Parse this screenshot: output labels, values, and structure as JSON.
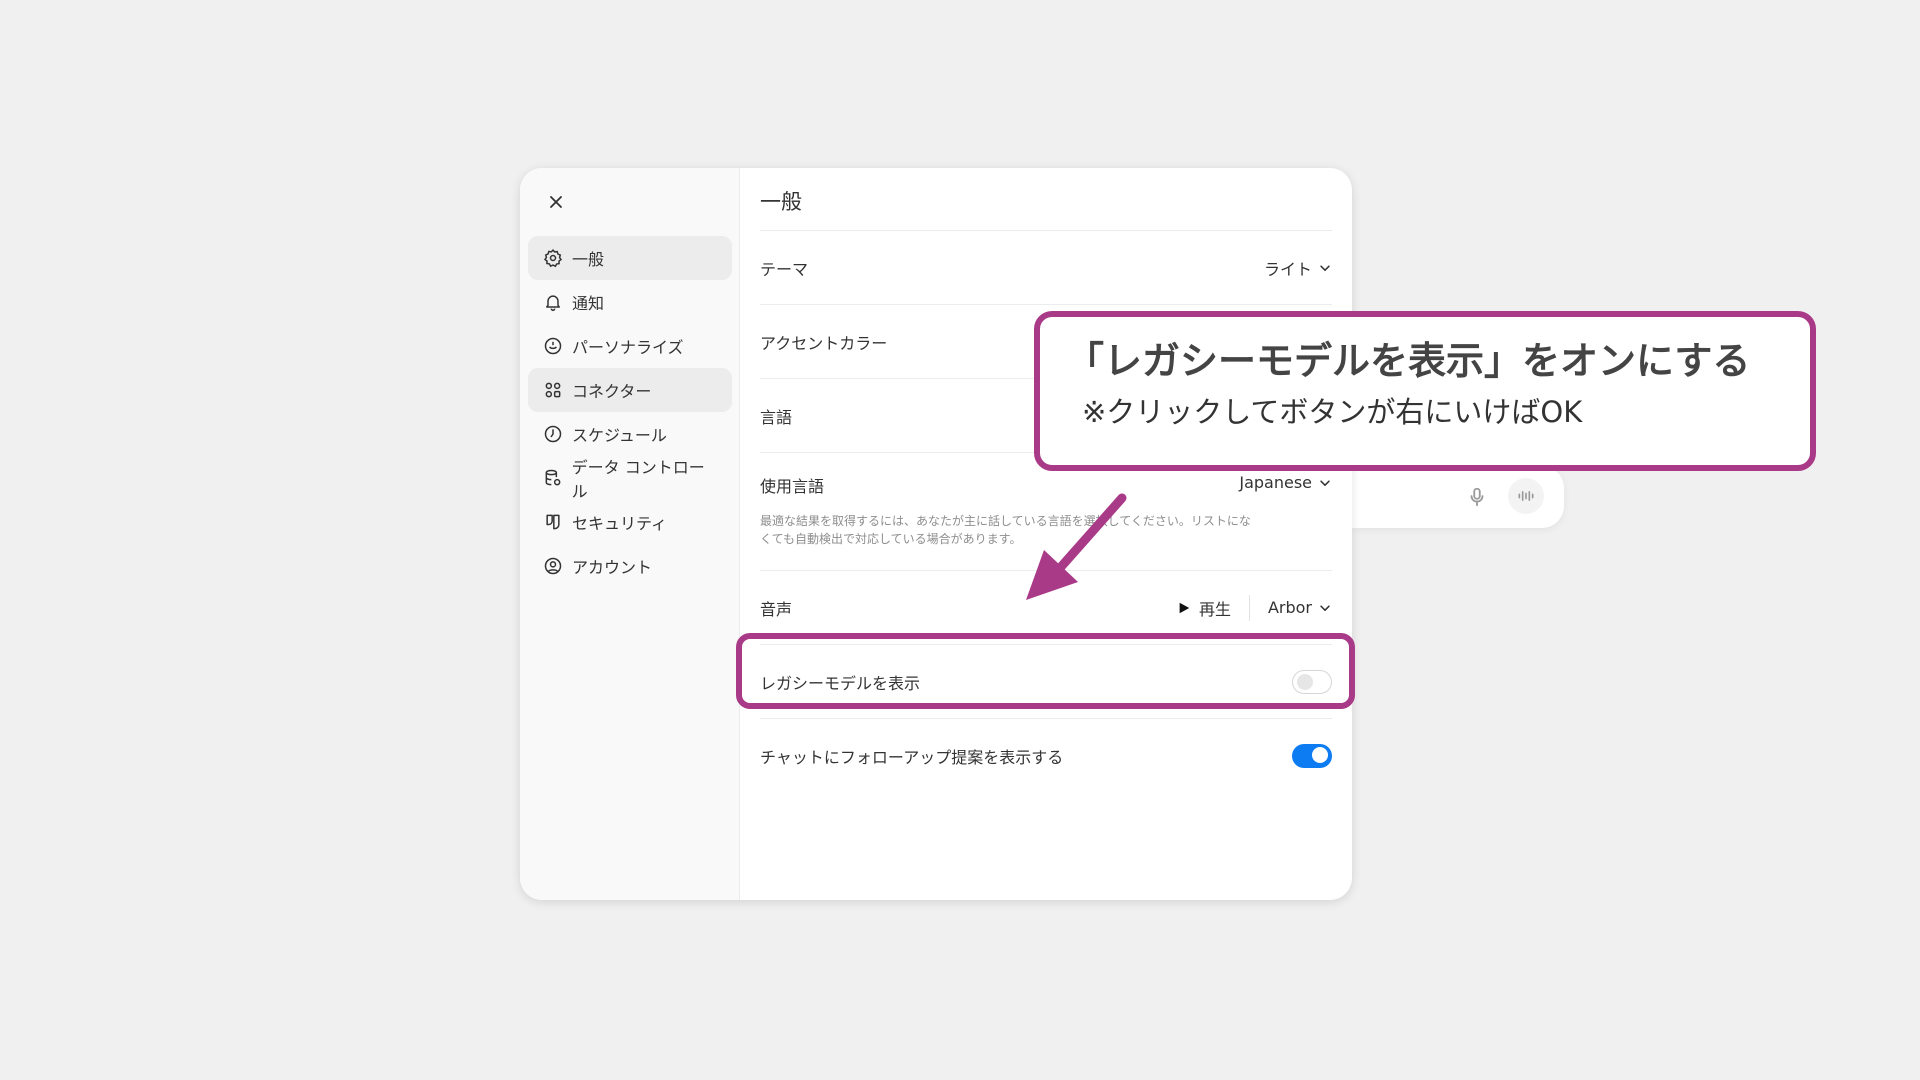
{
  "colors": {
    "accent": "#0d7cf2",
    "annotation": "#a93a87"
  },
  "sidebar": {
    "close_icon": "close-icon",
    "items": [
      {
        "label": "一般",
        "icon": "gear-icon",
        "active": true
      },
      {
        "label": "通知",
        "icon": "bell-icon",
        "active": false
      },
      {
        "label": "パーソナライズ",
        "icon": "personalize-icon",
        "active": false
      },
      {
        "label": "コネクター",
        "icon": "connector-icon",
        "active": true
      },
      {
        "label": "スケジュール",
        "icon": "clock-icon",
        "active": false
      },
      {
        "label": "データ コントロール",
        "icon": "database-icon",
        "active": false
      },
      {
        "label": "セキュリティ",
        "icon": "security-icon",
        "active": false
      },
      {
        "label": "アカウント",
        "icon": "account-icon",
        "active": false
      }
    ]
  },
  "main": {
    "title": "一般",
    "rows": {
      "theme": {
        "label": "テーマ",
        "value": "ライト"
      },
      "accent": {
        "label": "アクセントカラー"
      },
      "language": {
        "label": "言語"
      },
      "spoken_language": {
        "label": "使用言語",
        "value": "Japanese",
        "description": "最適な結果を取得するには、あなたが主に話している言語を選択してください。リストになくても自動検出で対応している場合があります。"
      },
      "voice": {
        "label": "音声",
        "play_label": "再生",
        "value": "Arbor"
      },
      "legacy_models": {
        "label": "レガシーモデルを表示",
        "toggle": "off"
      },
      "followups": {
        "label": "チャットにフォローアップ提案を表示する",
        "toggle": "on"
      }
    }
  },
  "annotation": {
    "title": "「レガシーモデルを表示」をオンにする",
    "subtitle": "※クリックしてボタンが右にいけばOK"
  }
}
